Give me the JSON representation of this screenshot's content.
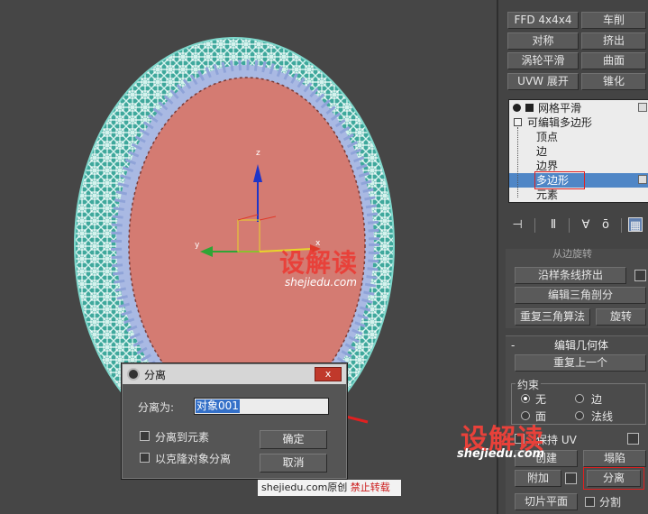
{
  "viewport": {
    "axes": {
      "z": "z",
      "y": "y",
      "x": "x"
    }
  },
  "panel": {
    "buttons": [
      {
        "label": "FFD 4x4x4"
      },
      {
        "label": "车削"
      },
      {
        "label": "对称"
      },
      {
        "label": "挤出"
      },
      {
        "label": "涡轮平滑"
      },
      {
        "label": "曲面"
      },
      {
        "label": "UVW 展开"
      },
      {
        "label": "锥化"
      }
    ],
    "stack": {
      "items": [
        {
          "label": "网格平滑"
        },
        {
          "label": "可编辑多边形"
        },
        {
          "label": "顶点"
        },
        {
          "label": "边"
        },
        {
          "label": "边界"
        },
        {
          "label": "多边形"
        },
        {
          "label": "元素"
        }
      ],
      "selected": "多边形"
    },
    "rollout_top": {
      "cut_label": "从边旋转",
      "extrude_along_spline": "沿样条线挤出",
      "edit_triangulation": "编辑三角剖分",
      "retriangulate": "重复三角算法",
      "turn": "旋转"
    },
    "edit_geometry": {
      "title": "编辑几何体",
      "repeat_last": "重复上一个",
      "constraints_label": "约束",
      "constraint_none": "无",
      "constraint_edge": "边",
      "constraint_face": "面",
      "constraint_normal": "法线",
      "preserve_uv": "保持 UV",
      "create": "创建",
      "collapse": "塌陷",
      "attach": "附加",
      "detach": "分离",
      "slice_plane": "切片平面",
      "split": "分割"
    }
  },
  "dialog": {
    "title": "分离",
    "close": "x",
    "name_label": "分离为:",
    "name_value": "对象001",
    "detach_to_element": "分离到元素",
    "detach_as_clone": "以克隆对象分离",
    "ok": "确定",
    "cancel": "取消"
  },
  "watermark": {
    "brand": "设解读",
    "domain": "shejiedu.com",
    "credit_site": "shejiedu.com",
    "credit_original": "原创",
    "credit_forbid": "禁止转载"
  },
  "colors": {
    "polygon_fill": "#d47b72",
    "wire_outer": "#5cc4b8",
    "vertex_ring": "#a9b9e3",
    "selection_blue": "#4f86c6",
    "highlight_red": "#e02020"
  }
}
